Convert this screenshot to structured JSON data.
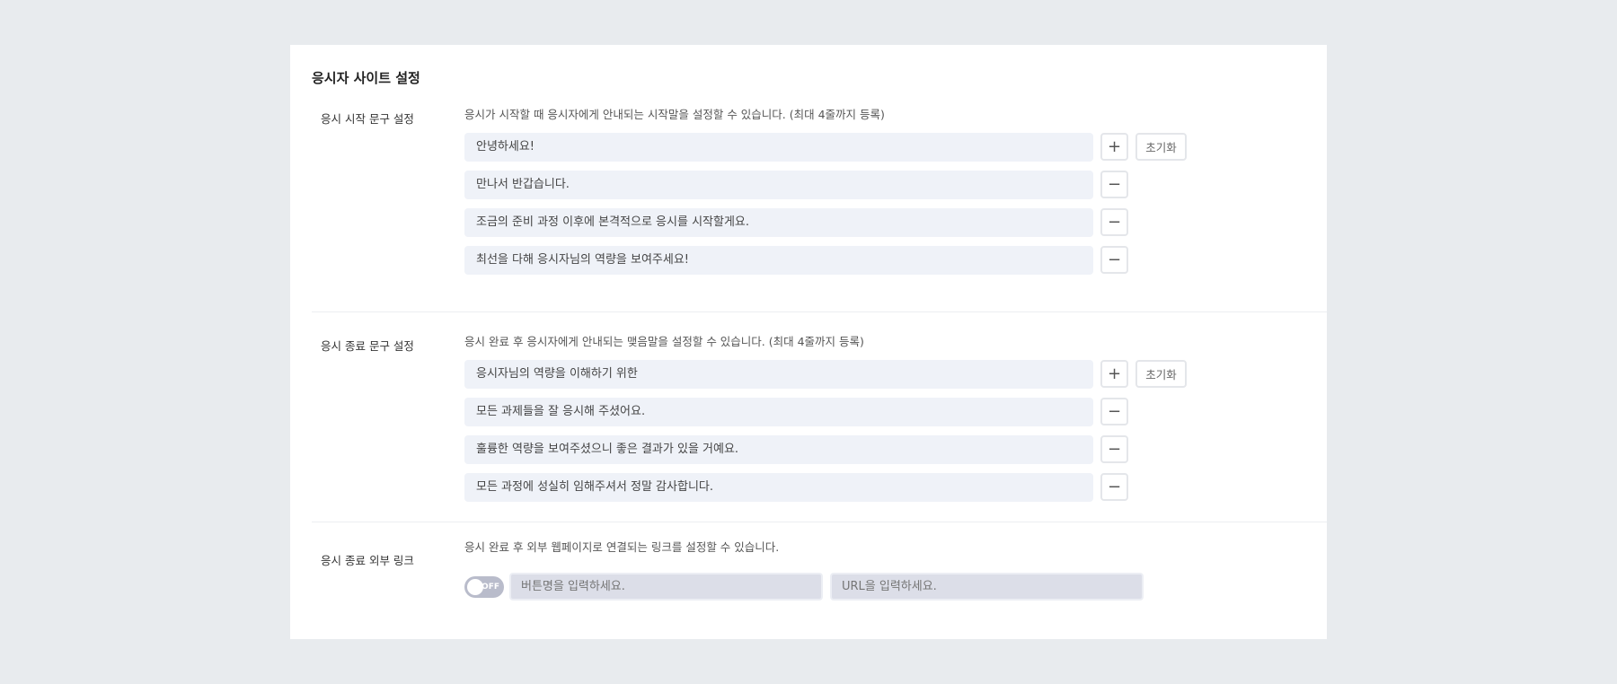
{
  "title": "응시자 사이트 설정",
  "start": {
    "label": "응시 시작 문구 설정",
    "desc": "응시가 시작할 때 응시자에게 안내되는 시작말을 설정할 수 있습니다. (최대 4줄까지 등록)",
    "lines": [
      "안녕하세요!",
      "만나서 반갑습니다.",
      "조금의 준비 과정 이후에 본격적으로 응시를 시작할게요.",
      "최선을 다해 응시자님의 역량을 보여주세요!"
    ]
  },
  "end": {
    "label": "응시 종료 문구 설정",
    "desc": "응시 완료 후 응시자에게 안내되는 맺음말을 설정할 수 있습니다. (최대 4줄까지 등록)",
    "lines": [
      "응시자님의 역량을 이해하기 위한",
      "모든 과제들을 잘 응시해 주셨어요.",
      "훌륭한 역량을 보여주셨으니 좋은 결과가 있을 거예요.",
      "모든 과정에 성실히 임해주셔서 정말 감사합니다."
    ]
  },
  "buttons": {
    "add": "+",
    "remove": "−",
    "reset": "초기화"
  },
  "link": {
    "label": "응시 종료 외부 링크",
    "desc": "응시 완료 후 외부 웹페이지로 연결되는 링크를 설정할 수 있습니다.",
    "toggle": "OFF",
    "button_placeholder": "버튼명을 입력하세요.",
    "url_placeholder": "URL을 입력하세요."
  }
}
